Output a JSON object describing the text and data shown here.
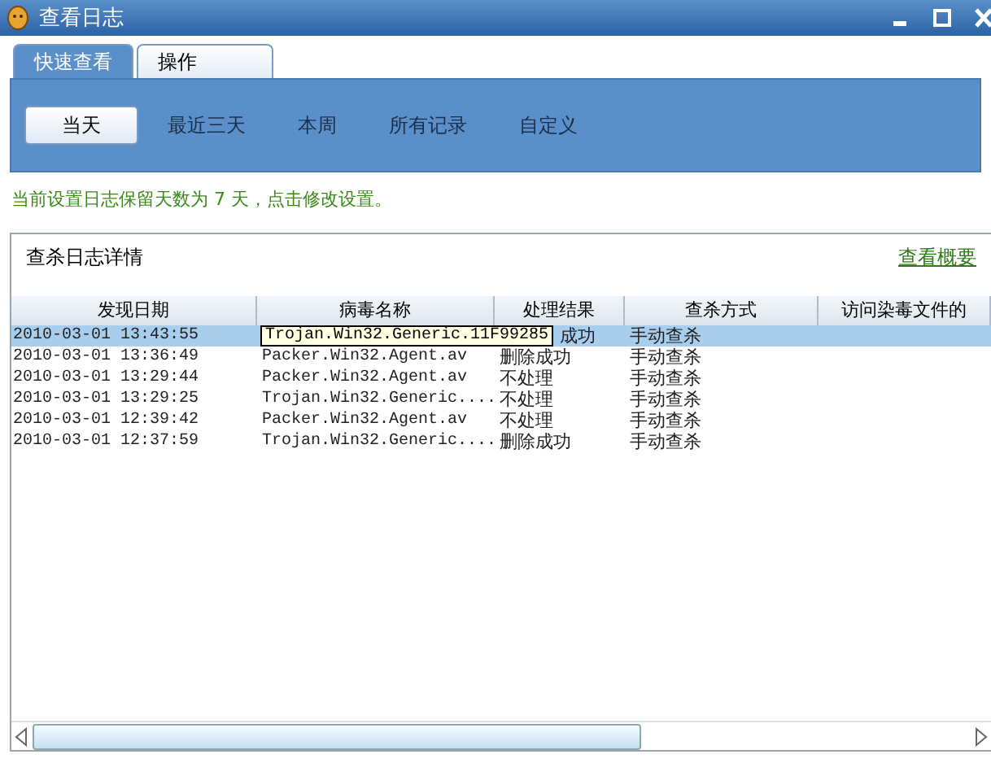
{
  "window": {
    "title": "查看日志"
  },
  "tabs": [
    {
      "label": "快速查看",
      "selected": true
    },
    {
      "label": "操作",
      "selected": false
    }
  ],
  "filters": [
    {
      "label": "当天",
      "selected": true
    },
    {
      "label": "最近三天",
      "selected": false
    },
    {
      "label": "本周",
      "selected": false
    },
    {
      "label": "所有记录",
      "selected": false
    },
    {
      "label": "自定义",
      "selected": false
    }
  ],
  "notice": "当前设置日志保留天数为 7 天，点击修改设置。",
  "details": {
    "title": "查杀日志详情",
    "link": "查看概要",
    "table": {
      "columns": [
        "发现日期",
        "病毒名称",
        "处理结果",
        "查杀方式",
        "访问染毒文件的"
      ],
      "rows": [
        {
          "date": "2010-03-01 13:43:55",
          "result": "成功",
          "method": "手动查杀",
          "selected": true
        },
        {
          "date": "2010-03-01 13:36:49",
          "name": "Packer.Win32.Agent.av",
          "result": "删除成功",
          "method": "手动查杀",
          "selected": false
        },
        {
          "date": "2010-03-01 13:29:44",
          "name": "Packer.Win32.Agent.av",
          "result": "不处理",
          "method": "手动查杀",
          "selected": false
        },
        {
          "date": "2010-03-01 13:29:25",
          "name": "Trojan.Win32.Generic....",
          "result": "不处理",
          "method": "手动查杀",
          "selected": false
        },
        {
          "date": "2010-03-01 12:39:42",
          "name": "Packer.Win32.Agent.av",
          "result": "不处理",
          "method": "手动查杀",
          "selected": false
        },
        {
          "date": "2010-03-01 12:37:59",
          "name": "Trojan.Win32.Generic....",
          "result": "删除成功",
          "method": "手动查杀",
          "selected": false
        }
      ],
      "tooltip": "Trojan.Win32.Generic.11F99285"
    }
  }
}
